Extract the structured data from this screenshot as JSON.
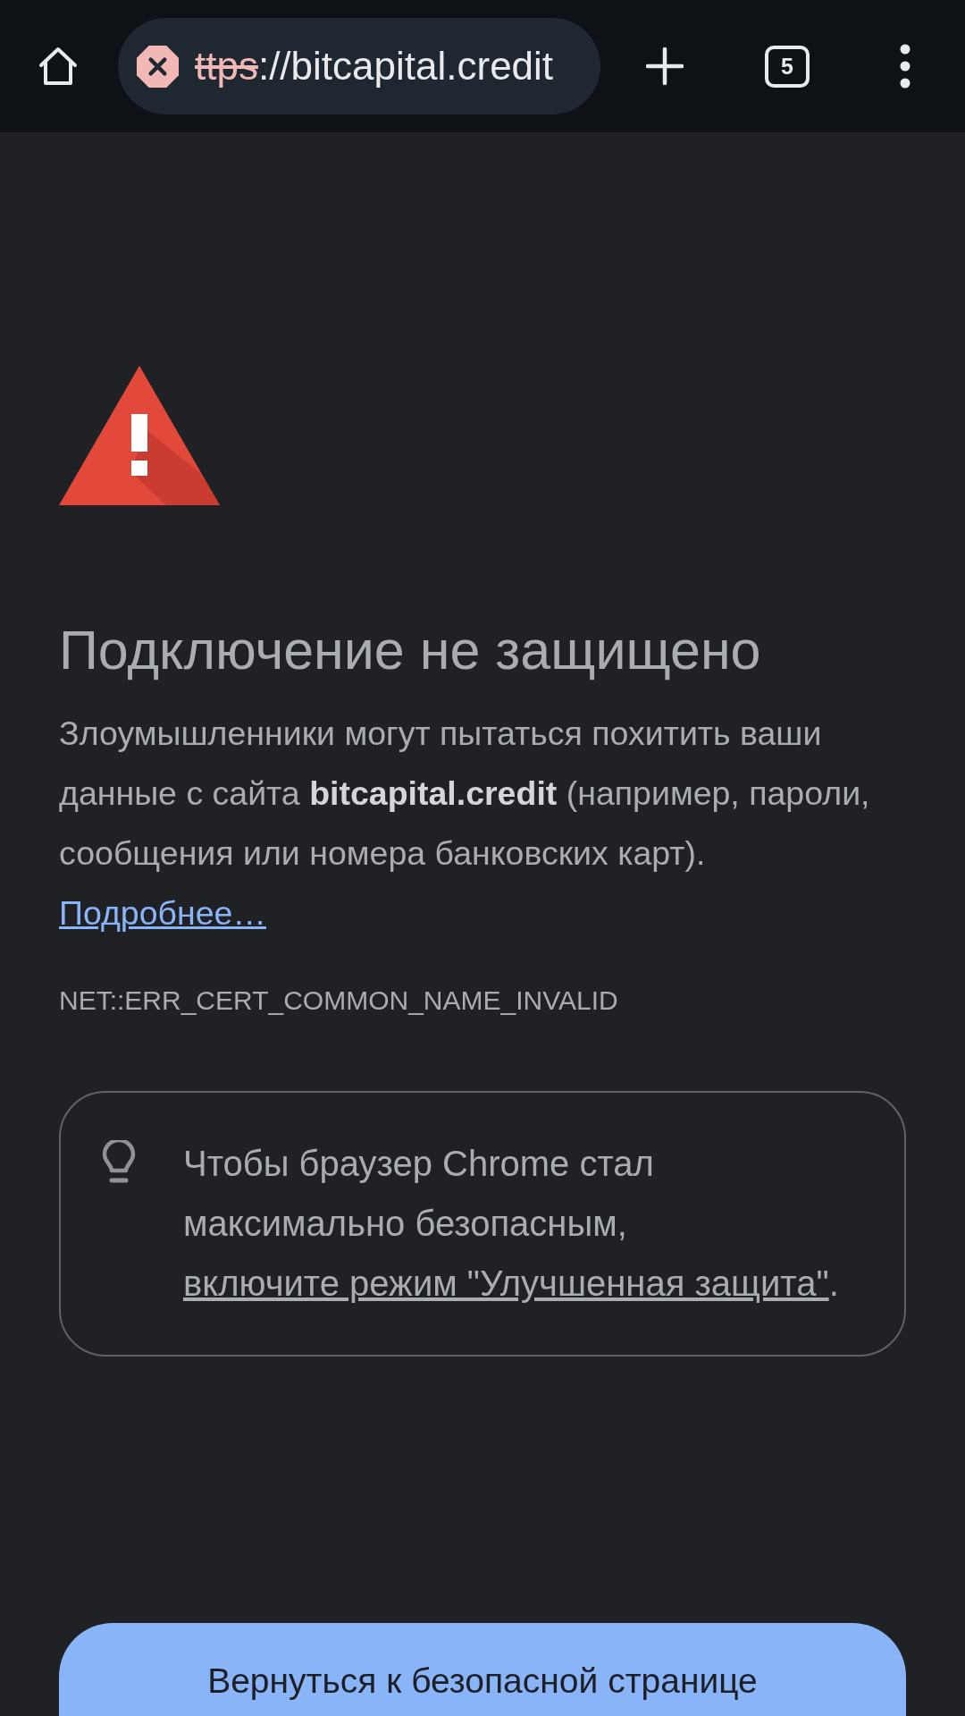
{
  "toolbar": {
    "url": {
      "secure": false,
      "scheme": "ttps",
      "rest": "://bitcapital.credit"
    },
    "tab_count": "5"
  },
  "interstitial": {
    "heading": "Подключение не защищено",
    "description": "Злоумышленники могут пытаться похитить ваши данные с сайта **bitcapital.credit** (например, пароли, сообщения или номера банковских карт).",
    "details_link": "Подробнее…",
    "error_code": "NET::ERR_CERT_COMMON_NAME_INVALID"
  },
  "hint": {
    "text": "Чтобы браузер Chrome стал максимально безопасным,",
    "link": "включите режим \"Улучшенная защита\"",
    "after": "."
  },
  "back_button": "Вернуться к безопасной странице"
}
